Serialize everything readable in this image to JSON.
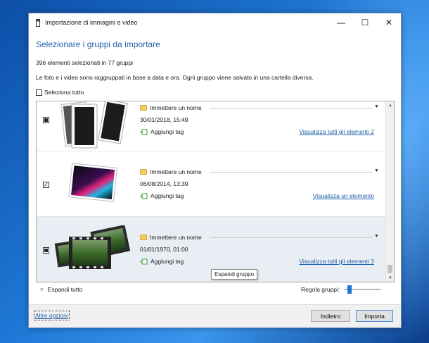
{
  "window": {
    "title": "Importazione di immagini e video",
    "minimize": "—",
    "maximize": "☐",
    "close": "✕"
  },
  "heading": "Selezionare i gruppi da importare",
  "count_text": "396 elementi selezionati in 77 gruppi",
  "description": "Le foto e i video sono raggruppati in base a data e ora. Ogni gruppo viene salvato in una cartella diversa.",
  "select_all_label": "Seleziona tutto",
  "groups": [
    {
      "name_placeholder": "Immettere un nome",
      "date": "30/01/2018, 15:49",
      "tag_label": "Aggiungi tag",
      "link": "Visualizza tutti gli elementi 2",
      "checkbox_state": "partial"
    },
    {
      "name_placeholder": "Immettere un nome",
      "date": "06/08/2014, 13:39",
      "tag_label": "Aggiungi tag",
      "link": "Visualizza un elemento",
      "checkbox_state": "checked"
    },
    {
      "name_placeholder": "Immettere un nome",
      "date": "01/01/1970, 01:00",
      "tag_label": "Aggiungi tag",
      "link": "Visualizza tutti gli elementi 3",
      "checkbox_state": "partial"
    }
  ],
  "tooltip": "Espandi gruppo",
  "expand_all_label": "Espandi tutto",
  "adjust_groups_label": "Regola gruppi:",
  "adjust_groups_level": 0.15,
  "more_options_link": "Altre opzioni",
  "back_button": "Indietro",
  "import_button": "Importa",
  "colors": {
    "accent": "#1d5fa8",
    "folder": "#f2cc60",
    "slider": "#1e73d2"
  },
  "icons": {
    "folder": "folder-icon",
    "tag": "tag-add-icon",
    "dropdown": "dropdown-arrow-icon",
    "expand": "chevron-down-icon"
  }
}
